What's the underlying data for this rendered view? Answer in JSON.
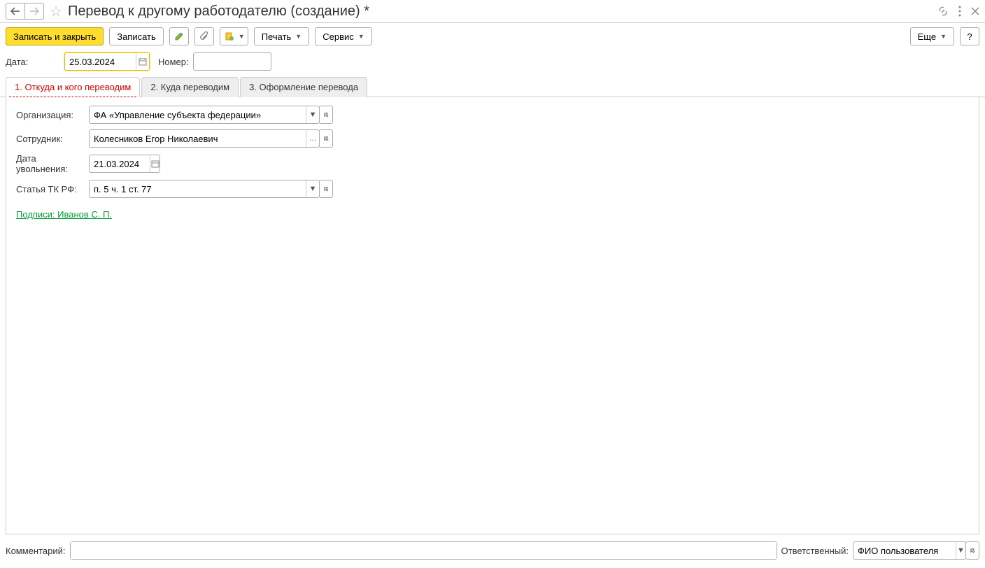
{
  "title": "Перевод к другому работодателю (создание) *",
  "toolbar": {
    "save_close": "Записать и закрыть",
    "save": "Записать",
    "print": "Печать",
    "service": "Сервис",
    "more": "Еще"
  },
  "header": {
    "date_label": "Дата:",
    "date_value": "25.03.2024",
    "number_label": "Номер:",
    "number_value": ""
  },
  "tabs": [
    "1. Откуда и кого переводим",
    "2. Куда переводим",
    "3. Оформление перевода"
  ],
  "form": {
    "org_label": "Организация:",
    "org_value": "ФА «Управление субъекта федерации»",
    "employee_label": "Сотрудник:",
    "employee_value": "Колесников Егор Николаевич",
    "dismiss_date_label": "Дата увольнения:",
    "dismiss_date_value": "21.03.2024",
    "article_label": "Статья ТК РФ:",
    "article_value": "п. 5 ч. 1 ст. 77",
    "signature": "Подписи: Иванов С. П."
  },
  "footer": {
    "comment_label": "Комментарий:",
    "comment_value": "",
    "responsible_label": "Ответственный:",
    "responsible_value": "ФИО пользователя"
  }
}
